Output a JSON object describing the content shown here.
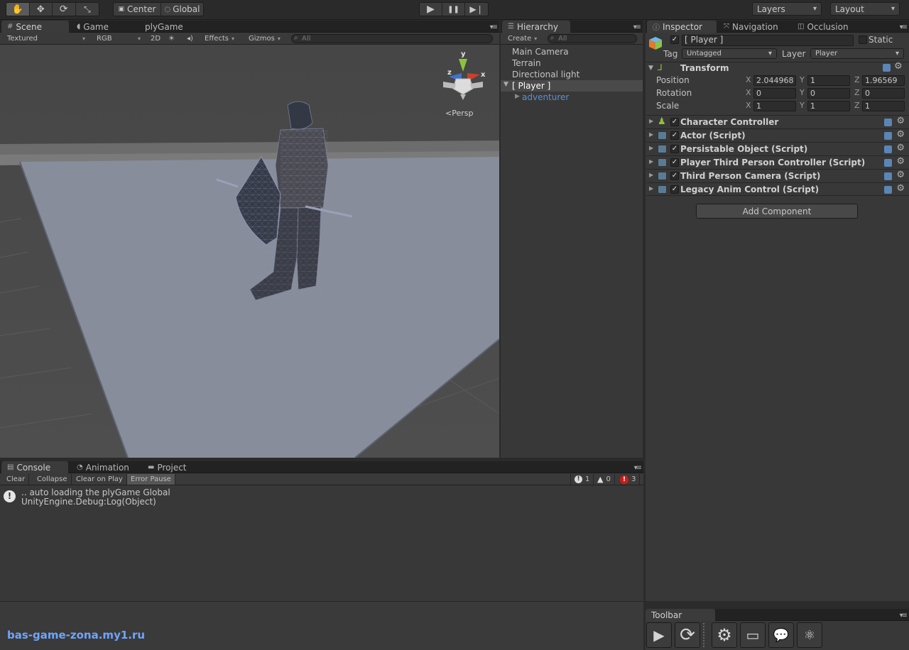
{
  "toolbar": {
    "tools": [
      "hand-tool",
      "move-tool",
      "rotate-tool",
      "scale-tool"
    ],
    "pivot_center": "Center",
    "pivot_global": "Global",
    "play": "▶",
    "pause": "❚❚",
    "step": "▶❘",
    "layers_label": "Layers",
    "layout_label": "Layout"
  },
  "scene_tabs": {
    "scene": "Scene",
    "game": "Game",
    "plygame": "plyGame"
  },
  "scene_bar": {
    "shading": "Textured",
    "render": "RGB",
    "mode2d": "2D",
    "sun": "☀",
    "audio": "◂)",
    "effects": "Effects",
    "gizmos": "Gizmos",
    "search": "All"
  },
  "scene_view": {
    "gizmo_y": "y",
    "gizmo_x": "x",
    "gizmo_z": "z",
    "projection": "Persp"
  },
  "hierarchy": {
    "tab": "Hierarchy",
    "create": "Create",
    "search": "All",
    "items": [
      "Main Camera",
      "Terrain",
      "Directional light",
      "[ Player ]",
      "adventurer"
    ]
  },
  "inspector_tabs": {
    "inspector": "Inspector",
    "navigation": "Navigation",
    "occlusion": "Occlusion"
  },
  "inspector": {
    "object_name": "[ Player ]",
    "static_label": "Static",
    "tag_label": "Tag",
    "tag_value": "Untagged",
    "layer_label": "Layer",
    "layer_value": "Player",
    "transform": {
      "title": "Transform",
      "position_label": "Position",
      "rotation_label": "Rotation",
      "scale_label": "Scale",
      "x": "X",
      "y": "Y",
      "z": "Z",
      "position": [
        "2.044968",
        "1",
        "1.96569"
      ],
      "rotation": [
        "0",
        "0",
        "0"
      ],
      "scale": [
        "1",
        "1",
        "1"
      ]
    },
    "components": [
      "Character Controller",
      "Actor (Script)",
      "Persistable Object (Script)",
      "Player Third Person Controller (Script)",
      "Third Person Camera (Script)",
      "Legacy Anim Control (Script)"
    ],
    "add_component": "Add Component"
  },
  "bottom_tabs": {
    "console": "Console",
    "animation": "Animation",
    "project": "Project"
  },
  "console": {
    "clear": "Clear",
    "collapse": "Collapse",
    "clear_on_play": "Clear on Play",
    "error_pause": "Error Pause",
    "info_count": "1",
    "warn_count": "0",
    "error_count": "3",
    "log_line1": ".. auto loading the plyGame Global",
    "log_line2": "UnityEngine.Debug:Log(Object)"
  },
  "toolbar_panel": {
    "title": "Toolbar"
  },
  "watermark": "bas-game-zona.my1.ru",
  "colors": {
    "selected_row": "#3e5f8a",
    "error_red": "#d01a1a",
    "link_blue": "#5b8fd6"
  }
}
